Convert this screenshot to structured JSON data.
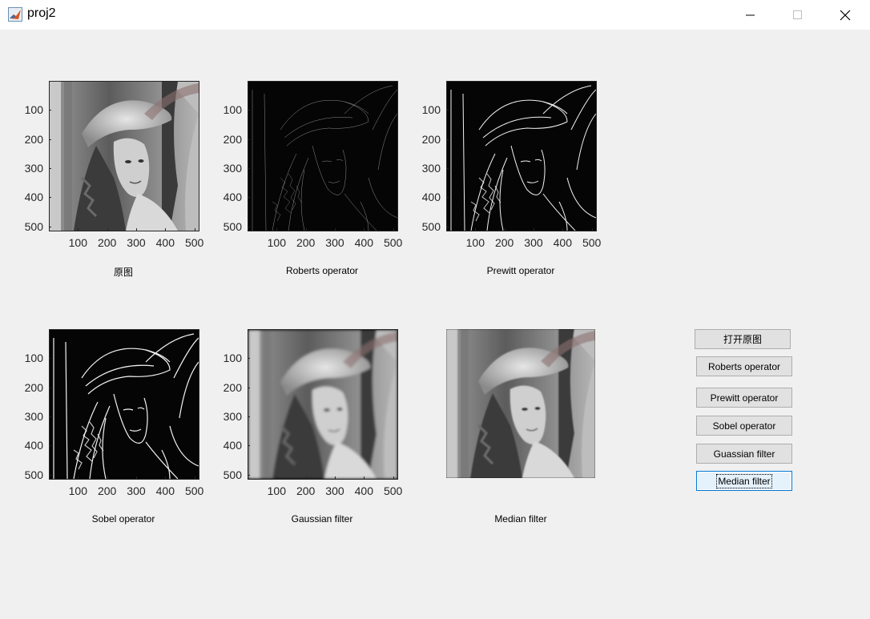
{
  "window": {
    "title": "proj2"
  },
  "plots": [
    {
      "id": "original",
      "caption": "原图",
      "filter": "contrast(1.05)"
    },
    {
      "id": "roberts",
      "caption": "Roberts operator",
      "filter": "edge-roberts"
    },
    {
      "id": "prewitt",
      "caption": "Prewitt operator",
      "filter": "edge-prewitt"
    },
    {
      "id": "sobel",
      "caption": "Sobel operator",
      "filter": "edge-sobel"
    },
    {
      "id": "gaussian",
      "caption": "Gaussian filter",
      "filter": "blur"
    },
    {
      "id": "median",
      "caption": "Median filter",
      "filter": "smooth"
    }
  ],
  "axis_ticks": [
    "100",
    "200",
    "300",
    "400",
    "500"
  ],
  "buttons": [
    {
      "label": "打开原图"
    },
    {
      "label": "Roberts operator"
    },
    {
      "label": "Prewitt operator"
    },
    {
      "label": "Sobel operator"
    },
    {
      "label": "Guassian filter"
    },
    {
      "label": "Median filter"
    }
  ]
}
